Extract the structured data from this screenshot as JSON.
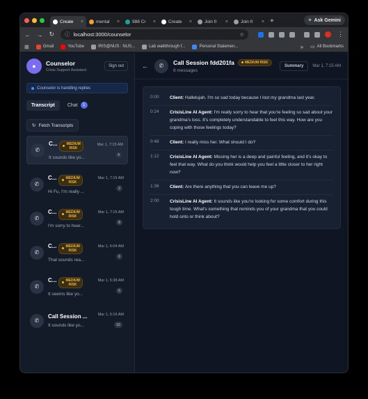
{
  "browser": {
    "tabs": [
      {
        "label": "Create",
        "icon_color": "#ffffff",
        "active": true
      },
      {
        "label": "mental",
        "icon_color": "#f29d38",
        "active": false
      },
      {
        "label": "988 Cr",
        "icon_color": "#1aa39a",
        "active": false
      },
      {
        "label": "Create",
        "icon_color": "#ffffff",
        "active": false
      },
      {
        "label": "Join fr",
        "icon_color": "#9aa0a6",
        "active": false
      },
      {
        "label": "Join fr",
        "icon_color": "#9aa0a6",
        "active": false
      }
    ],
    "new_tab": "+",
    "ask_gemini": "Ask Gemini",
    "url": "localhost:3000/counselor",
    "bookmarks": [
      {
        "label": "Gmail",
        "color": "#ea4335"
      },
      {
        "label": "YouTube",
        "color": "#ff0000"
      },
      {
        "label": "IRIS@NUS : NUS...",
        "color": "#9aa0a6"
      },
      {
        "label": "Lab walkthrough f...",
        "color": "#9aa0a6"
      },
      {
        "label": "Personal Statemen...",
        "color": "#4285f4"
      }
    ],
    "more_bookmarks": "»",
    "all_bookmarks": "All Bookmarks"
  },
  "sidebar": {
    "title": "Counselor",
    "subtitle": "Crisis Support Assistant",
    "sign_out": "Sign out",
    "status": "Counselor is handling replies",
    "tabs": {
      "transcript": "Transcript",
      "chat": "Chat",
      "chat_badge": "1"
    },
    "fetch": "Fetch Transcripts",
    "sessions": [
      {
        "title": "C...",
        "risk": "MEDIUM RISK",
        "time": "Mar 1, 7:15 AM",
        "count": "4",
        "preview": "It sounds like yo...",
        "selected": true
      },
      {
        "title": "C...",
        "risk": "MEDIUM RISK",
        "time": "Mar 1, 7:15 AM",
        "count": "2",
        "preview": "Hi Fu, I'm really ...",
        "selected": false
      },
      {
        "title": "C...",
        "risk": "MEDIUM RISK",
        "time": "Mar 1, 7:15 AM",
        "count": "8",
        "preview": "I'm sorry to hear...",
        "selected": false
      },
      {
        "title": "C...",
        "risk": "MEDIUM RISK",
        "time": "Mar 1, 6:04 AM",
        "count": "6",
        "preview": "That sounds rea...",
        "selected": false
      },
      {
        "title": "C...",
        "risk": "MEDIUM RISK",
        "time": "Mar 1, 5:38 AM",
        "count": "6",
        "preview": "It seems like yo...",
        "selected": false
      },
      {
        "title": "Call Session ...",
        "risk": "",
        "time": "Mar 1, 5:16 AM",
        "count": "16",
        "preview": "It sounds like yo...",
        "selected": false
      }
    ]
  },
  "main": {
    "title": "Call Session fdd201fa",
    "risk": "MEDIUM RISK",
    "messages": "6 messages",
    "summary": "Summary",
    "time": "Mar 1, 7:15 AM",
    "transcript": [
      {
        "time": "0:00",
        "speaker": "Client:",
        "text": "Hallelujah. I'm so sad today because I lost my grandma last year."
      },
      {
        "time": "0:24",
        "speaker": "CrisisLine AI Agent:",
        "text": "I'm really sorry to hear that you're feeling so sad about your grandma's loss. It's completely understandable to feel this way. How are you coping with those feelings today?"
      },
      {
        "time": "0:48",
        "speaker": "Client:",
        "text": "I really miss her. What should I do?"
      },
      {
        "time": "1:12",
        "speaker": "CrisisLine AI Agent:",
        "text": "Missing her is a deep and painful feeling, and it's okay to feel that way. What do you think would help you feel a little closer to her right now?"
      },
      {
        "time": "1:36",
        "speaker": "Client:",
        "text": "Are there anything that you can leave me up?"
      },
      {
        "time": "2:00",
        "speaker": "CrisisLine AI Agent:",
        "text": "It sounds like you're looking for some comfort during this tough time. What's something that reminds you of your grandma that you could hold onto or think about?"
      }
    ]
  }
}
